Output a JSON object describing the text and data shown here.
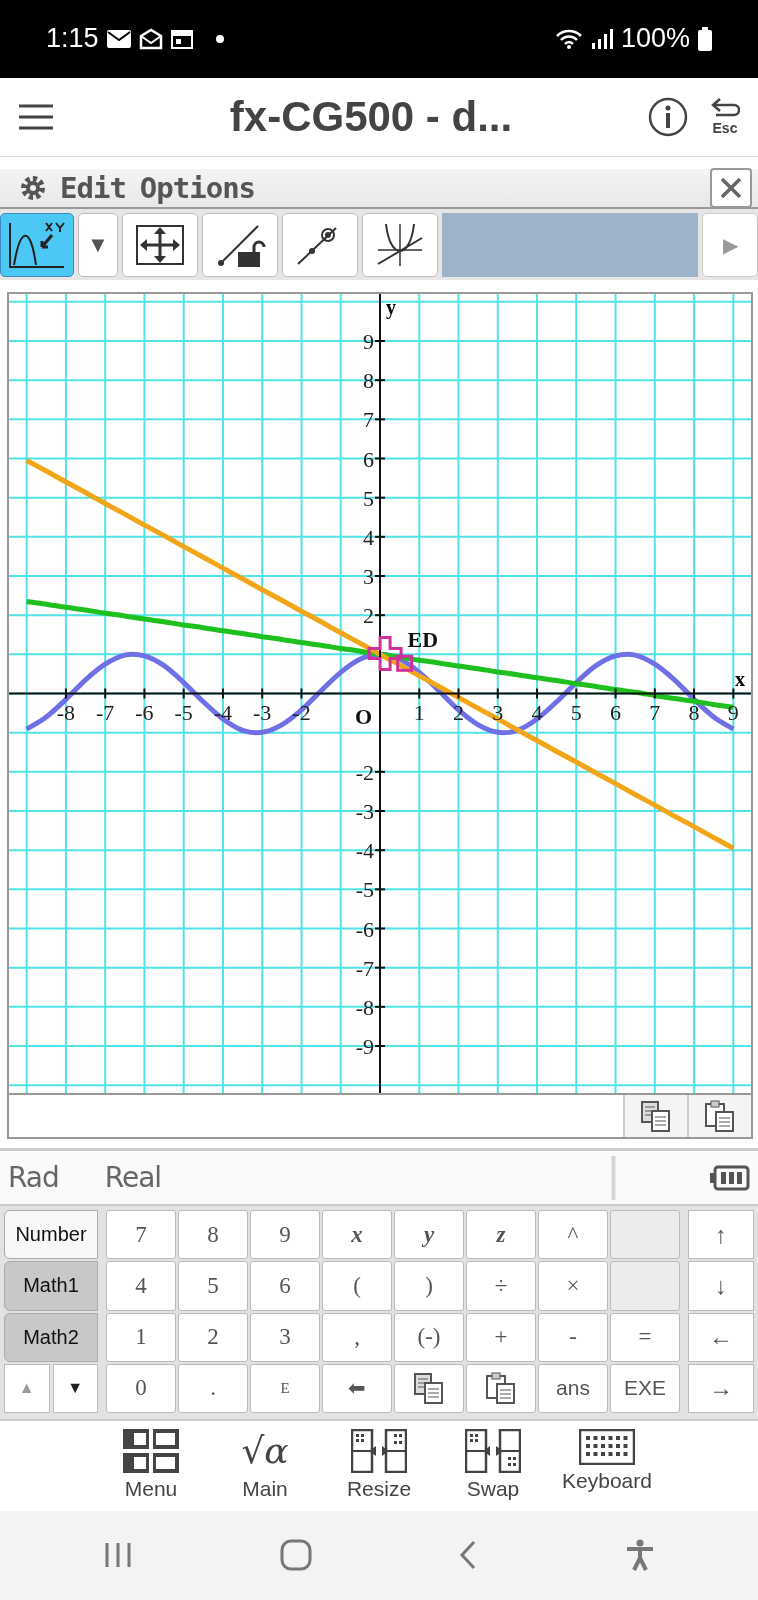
{
  "status_bar": {
    "time": "1:15",
    "battery": "100%"
  },
  "app_bar": {
    "title": "fx-CG500 - d...",
    "esc_label": "Esc"
  },
  "menu_bar": {
    "items": [
      "Edit",
      "Options"
    ]
  },
  "toolbar": {
    "tools": [
      {
        "kind": "trace",
        "selected": true
      },
      {
        "kind": "dropdown",
        "label": "▼",
        "selected": false
      },
      {
        "kind": "zoom",
        "selected": false
      },
      {
        "kind": "lock",
        "selected": false
      },
      {
        "kind": "point",
        "selected": false
      },
      {
        "kind": "curves",
        "selected": false
      }
    ],
    "scroll_arrow": {
      "label": "▶",
      "disabled": true
    }
  },
  "graph": {
    "chart_data": {
      "type": "line",
      "grid": true,
      "xlabel": "x",
      "ylabel": "y",
      "xlim": [
        -9.45,
        9.45
      ],
      "ylim": [
        -10.2,
        10.2
      ],
      "x": [
        -9,
        -8.5,
        -8,
        -7.5,
        -7,
        -6.5,
        -6,
        -5.5,
        -5,
        -4.5,
        -4,
        -3.5,
        -3,
        -2.5,
        -2,
        -1.5,
        -1,
        -0.5,
        0,
        0.5,
        1,
        1.5,
        2,
        2.5,
        3,
        3.5,
        4,
        4.5,
        5,
        5.5,
        6,
        6.5,
        7,
        7.5,
        8,
        8.5,
        9
      ],
      "series": [
        {
          "color": "#6f6fe6",
          "values": [
            -0.91,
            -0.6,
            -0.15,
            0.35,
            0.75,
            0.98,
            0.96,
            0.71,
            0.28,
            -0.21,
            -0.65,
            -0.94,
            -0.99,
            -0.8,
            -0.42,
            0.07,
            0.54,
            0.88,
            1,
            0.88,
            0.54,
            0.07,
            -0.42,
            -0.8,
            -0.99,
            -0.94,
            -0.65,
            -0.21,
            0.28,
            0.71,
            0.96,
            0.98,
            0.75,
            0.35,
            -0.15,
            -0.6,
            -0.91
          ]
        },
        {
          "color": "#1fbf1f",
          "values": [
            2.35,
            2.28,
            2.2,
            2.13,
            2.05,
            1.98,
            1.9,
            1.83,
            1.75,
            1.68,
            1.6,
            1.53,
            1.45,
            1.38,
            1.3,
            1.23,
            1.15,
            1.08,
            1,
            0.93,
            0.85,
            0.78,
            0.7,
            0.63,
            0.55,
            0.48,
            0.4,
            0.33,
            0.25,
            0.18,
            0.1,
            0.03,
            -0.05,
            -0.13,
            -0.2,
            -0.28,
            -0.35
          ]
        },
        {
          "color": "#f2a516",
          "values": [
            5.95,
            5.68,
            5.4,
            5.13,
            4.85,
            4.58,
            4.3,
            4.03,
            3.75,
            3.48,
            3.2,
            2.93,
            2.65,
            2.38,
            2.1,
            1.83,
            1.55,
            1.28,
            1,
            0.73,
            0.45,
            0.18,
            -0.1,
            -0.38,
            -0.65,
            -0.93,
            -1.2,
            -1.48,
            -1.75,
            -2.03,
            -2.3,
            -2.58,
            -2.85,
            -3.13,
            -3.4,
            -3.68,
            -3.95
          ]
        }
      ],
      "xticks": [
        -8,
        -7,
        -6,
        -5,
        -4,
        -3,
        -2,
        1,
        2,
        3,
        4,
        5,
        6,
        7,
        8,
        9
      ],
      "yticks": [
        9,
        8,
        7,
        6,
        5,
        4,
        3,
        2,
        -2,
        -3,
        -4,
        -5,
        -6,
        -7,
        -8,
        -9
      ],
      "annotations": [
        "O",
        "ED"
      ]
    }
  },
  "entry_line": {
    "actions": [
      {
        "kind": "copy"
      },
      {
        "kind": "paste"
      }
    ]
  },
  "mode_line": {
    "angle": "Rad",
    "number_mode": "Real"
  },
  "keyboard": {
    "tabs": [
      {
        "label": "Number",
        "selected": true
      },
      {
        "label": "Math1",
        "selected": false
      },
      {
        "label": "Math2",
        "selected": false
      }
    ],
    "page_up": {
      "label": "▲",
      "disabled": true
    },
    "page_down": {
      "label": "▼",
      "disabled": false
    },
    "keys": [
      [
        {
          "kind": "serif",
          "label": "7"
        },
        {
          "kind": "serif",
          "label": "8"
        },
        {
          "kind": "serif",
          "label": "9"
        },
        {
          "kind": "var",
          "label": "x"
        },
        {
          "kind": "var",
          "label": "y"
        },
        {
          "kind": "var",
          "label": "z"
        },
        {
          "kind": "serif",
          "label": "^"
        },
        {
          "kind": "blank"
        }
      ],
      [
        {
          "kind": "serif",
          "label": "4"
        },
        {
          "kind": "serif",
          "label": "5"
        },
        {
          "kind": "serif",
          "label": "6"
        },
        {
          "kind": "serif",
          "label": "("
        },
        {
          "kind": "serif",
          "label": ")"
        },
        {
          "kind": "serif",
          "label": "÷"
        },
        {
          "kind": "serif",
          "label": "×"
        },
        {
          "kind": "blank"
        }
      ],
      [
        {
          "kind": "serif",
          "label": "1"
        },
        {
          "kind": "serif",
          "label": "2"
        },
        {
          "kind": "serif",
          "label": "3"
        },
        {
          "kind": "serif",
          "label": ","
        },
        {
          "kind": "serif",
          "label": "(-)"
        },
        {
          "kind": "serif",
          "label": "+"
        },
        {
          "kind": "serif",
          "label": "-"
        },
        {
          "kind": "serif",
          "label": "="
        }
      ],
      [
        {
          "kind": "serif",
          "label": "0"
        },
        {
          "kind": "serif",
          "label": "."
        },
        {
          "kind": "small",
          "label": "E"
        },
        {
          "kind": "sans",
          "label": "⬅"
        },
        {
          "kind": "copy"
        },
        {
          "kind": "paste"
        },
        {
          "kind": "sans",
          "label": "ans"
        },
        {
          "kind": "sans",
          "label": "EXE"
        }
      ]
    ],
    "arrows": [
      "↑",
      "↓",
      "←",
      "→"
    ]
  },
  "bottom_bar": [
    {
      "kind": "menu",
      "label": "Menu"
    },
    {
      "kind": "main",
      "label": "Main",
      "icon_text": "√α"
    },
    {
      "kind": "resize",
      "label": "Resize"
    },
    {
      "kind": "swap",
      "label": "Swap"
    },
    {
      "kind": "keyboard",
      "label": "Keyboard"
    }
  ]
}
